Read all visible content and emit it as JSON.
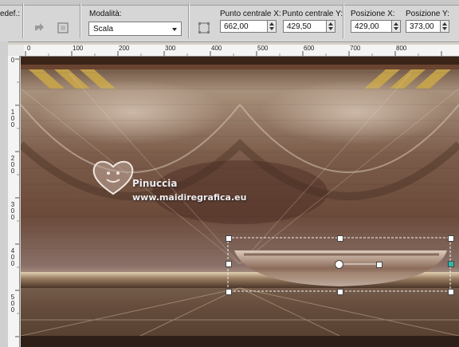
{
  "toolbar": {
    "preset_label": "edef.:",
    "mode_label": "Modalità:",
    "mode_value": "Scala",
    "center_x_label": "Punto centrale X:",
    "center_x_value": "662,00",
    "center_y_label": "Punto centrale Y:",
    "center_y_value": "429,50",
    "pos_x_label": "Posizione X:",
    "pos_x_value": "429,00",
    "pos_y_label": "Posizione Y:",
    "pos_y_value": "373,00"
  },
  "ruler_h": [
    "0",
    "100",
    "200",
    "300",
    "400",
    "500",
    "600",
    "700",
    "800"
  ],
  "ruler_v": [
    {
      "d1": "0",
      "d2": ""
    },
    {
      "d1": "1",
      "d2": "0"
    },
    {
      "d1": "2",
      "d2": "0"
    },
    {
      "d1": "3",
      "d2": "0"
    },
    {
      "d1": "4",
      "d2": "0"
    },
    {
      "d1": "5",
      "d2": "0"
    }
  ],
  "watermark": {
    "name": "Pinuccia",
    "site": "www.maidiregrafica.eu"
  },
  "colors": {
    "toolbar_bg": "#d6d6d6",
    "selection_handle": "#ffffff",
    "center_handle_accent": "#2fb8a6"
  }
}
